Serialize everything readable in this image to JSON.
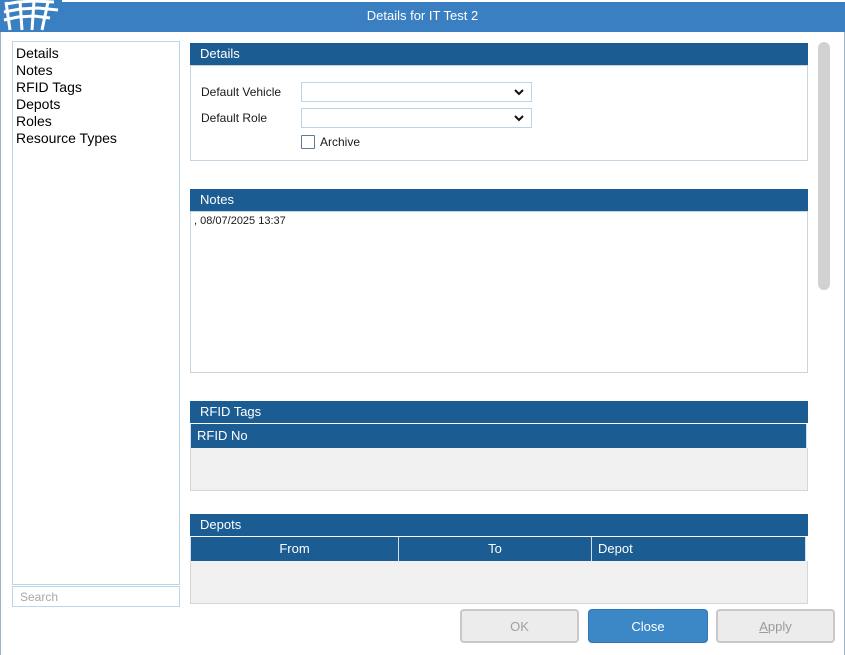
{
  "window": {
    "title": "Details for IT Test 2"
  },
  "nav": {
    "items": [
      "Details",
      "Notes",
      "RFID Tags",
      "Depots",
      "Roles",
      "Resource Types"
    ],
    "search_placeholder": "Search"
  },
  "details": {
    "header": "Details",
    "default_vehicle_label": "Default Vehicle",
    "default_vehicle_value": "",
    "default_role_label": "Default Role",
    "default_role_value": "",
    "archive_label": "Archive",
    "archive_checked": false
  },
  "notes": {
    "header": "Notes",
    "text": ", 08/07/2025 13:37"
  },
  "rfid": {
    "header": "RFID Tags",
    "columns": [
      "RFID No"
    ],
    "rows": []
  },
  "depots": {
    "header": "Depots",
    "columns": [
      "From",
      "To",
      "Depot"
    ],
    "rows": []
  },
  "buttons": {
    "ok": "OK",
    "close": "Close",
    "apply_first": "A",
    "apply_rest": "pply"
  },
  "colors": {
    "titlebar": "#3a7fc1",
    "section_header": "#1b5c93",
    "primary_button": "#3c88c6"
  }
}
